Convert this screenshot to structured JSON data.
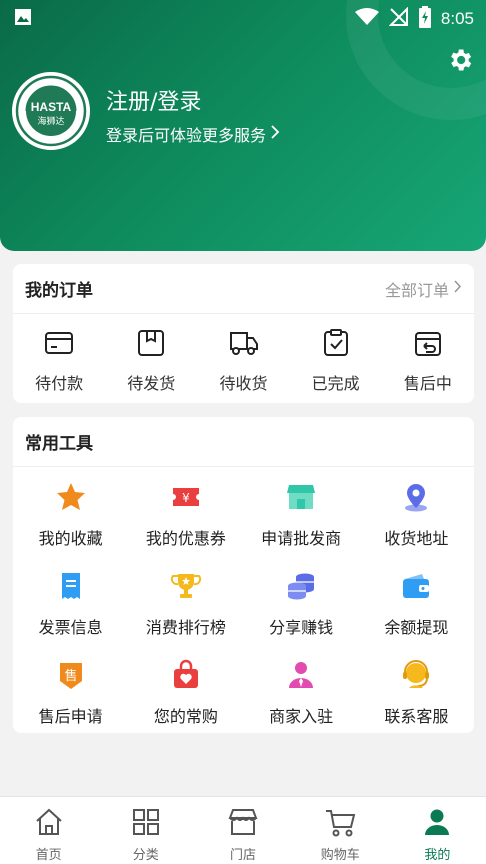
{
  "status_bar": {
    "time": "8:05"
  },
  "colors": {
    "primary": "#0b7a52",
    "header_start": "#0a6a48",
    "header_end": "#17a676"
  },
  "profile": {
    "avatar_brand": "HASTA",
    "avatar_brand_cn": "海狮达",
    "title": "注册/登录",
    "subtitle": "登录后可体验更多服务"
  },
  "orders": {
    "title": "我的订单",
    "more_label": "全部订单",
    "items": [
      {
        "label": "待付款",
        "icon": "card-icon"
      },
      {
        "label": "待发货",
        "icon": "package-icon"
      },
      {
        "label": "待收货",
        "icon": "truck-icon"
      },
      {
        "label": "已完成",
        "icon": "clipboard-check-icon"
      },
      {
        "label": "售后中",
        "icon": "return-box-icon"
      }
    ]
  },
  "tools": {
    "title": "常用工具",
    "items": [
      {
        "label": "我的收藏",
        "icon": "star-icon",
        "color": "#f08a1c"
      },
      {
        "label": "我的优惠券",
        "icon": "coupon-icon",
        "color": "#e93f3f"
      },
      {
        "label": "申请批发商",
        "icon": "shop-icon",
        "color": "#2fc7a8"
      },
      {
        "label": "收货地址",
        "icon": "location-icon",
        "color": "#5b6de6"
      },
      {
        "label": "发票信息",
        "icon": "invoice-icon",
        "color": "#2f9df4"
      },
      {
        "label": "消费排行榜",
        "icon": "trophy-icon",
        "color": "#f5b91e"
      },
      {
        "label": "分享赚钱",
        "icon": "coins-icon",
        "color": "#5b6de6"
      },
      {
        "label": "余额提现",
        "icon": "wallet-icon",
        "color": "#2f9df4"
      },
      {
        "label": "售后申请",
        "icon": "aftersale-badge-icon",
        "color": "#f08a1c"
      },
      {
        "label": "您的常购",
        "icon": "heart-bag-icon",
        "color": "#e93f3f"
      },
      {
        "label": "商家入驻",
        "icon": "merchant-icon",
        "color": "#e24bb0"
      },
      {
        "label": "联系客服",
        "icon": "headset-icon",
        "color": "#f5b91e"
      }
    ]
  },
  "nav": {
    "items": [
      {
        "label": "首页",
        "icon": "home-icon"
      },
      {
        "label": "分类",
        "icon": "grid-icon"
      },
      {
        "label": "门店",
        "icon": "store-icon"
      },
      {
        "label": "购物车",
        "icon": "cart-icon"
      },
      {
        "label": "我的",
        "icon": "user-icon",
        "active": true
      }
    ]
  }
}
